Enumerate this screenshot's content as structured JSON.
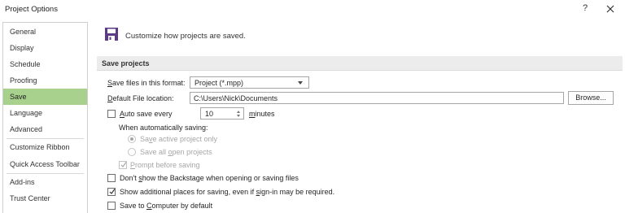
{
  "window": {
    "title": "Project Options",
    "help_label": "?",
    "close_icon": "close-icon"
  },
  "sidebar": {
    "items": [
      {
        "label": "General",
        "selected": false
      },
      {
        "label": "Display",
        "selected": false
      },
      {
        "label": "Schedule",
        "selected": false
      },
      {
        "label": "Proofing",
        "selected": false
      },
      {
        "label": "Save",
        "selected": true
      },
      {
        "label": "Language",
        "selected": false
      },
      {
        "label": "Advanced",
        "selected": false
      },
      {
        "label": "Customize Ribbon",
        "selected": false
      },
      {
        "label": "Quick Access Toolbar",
        "selected": false
      },
      {
        "label": "Add-ins",
        "selected": false
      },
      {
        "label": "Trust Center",
        "selected": false
      }
    ],
    "selected_color": "#a9d18e"
  },
  "main": {
    "header_icon": "floppy-disk-icon",
    "header_text": "Customize how projects are saved.",
    "section_title": "Save projects",
    "save_format": {
      "label_prefix": "",
      "label_accel": "S",
      "label_rest": "ave files in this format:",
      "value": "Project (*.mpp)"
    },
    "default_location": {
      "label_accel": "D",
      "label_rest": "efault File location:",
      "value": "C:\\Users\\Nick\\Documents",
      "browse_label": "Browse..."
    },
    "autosave": {
      "checked": false,
      "label_accel": "A",
      "label_rest": "uto save every",
      "interval": "10",
      "unit_accel": "m",
      "unit_rest": "inutes",
      "when_label": "When automatically saving:",
      "opt_active_a": "Sa",
      "opt_active_accel": "v",
      "opt_active_b": "e active project only",
      "opt_all_a": "Save all ",
      "opt_all_accel": "o",
      "opt_all_b": "pen projects",
      "prompt_accel": "P",
      "prompt_rest": "rompt before saving",
      "prompt_checked": true
    },
    "options": [
      {
        "checked": false,
        "a": "Don't ",
        "accel": "s",
        "b": "how the Backstage when opening or saving files"
      },
      {
        "checked": true,
        "a": "Show additional places for saving, even if ",
        "accel": "s",
        "b": "ign-in may be required."
      },
      {
        "checked": false,
        "a": "Save to ",
        "accel": "C",
        "b": "omputer by default"
      }
    ]
  },
  "colors": {
    "accent_selected": "#a9d18e",
    "section_bar": "#ececec",
    "disabled_text": "#a6a6a6"
  }
}
